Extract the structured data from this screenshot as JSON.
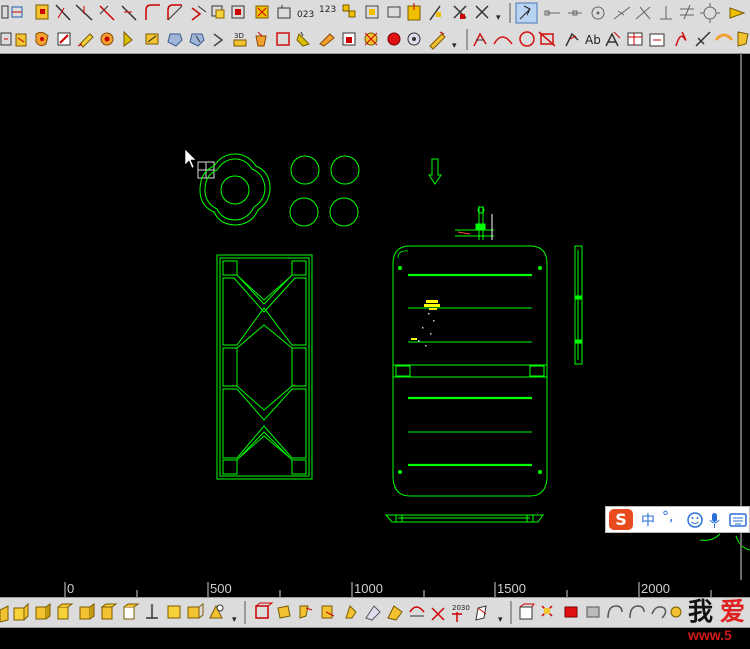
{
  "toolbars": {
    "top_row": {
      "icons": [
        "polyline-icon",
        "select-icon",
        "trim-icon",
        "extend-icon",
        "break-icon",
        "chamfer-icon",
        "fillet-icon",
        "offset-icon",
        "rotate-icon",
        "move-icon",
        "copy-icon",
        "array-icon",
        "explode-icon",
        "stretch-icon",
        "match-icon",
        "hatch-icon",
        "snap-icon",
        "line-icon",
        "circle-icon",
        "constraint-icon",
        "mirror-icon",
        "dimension-icon",
        "equal-icon"
      ],
      "text_labels": [
        "023",
        "123"
      ]
    },
    "second_row": {
      "icons": [
        "block-icon",
        "layer-icon",
        "properties-icon",
        "paint-icon",
        "pencil-icon",
        "insert-icon",
        "draw-order-icon",
        "3d-icon",
        "bucket-icon",
        "rectangle-icon",
        "eraser-icon",
        "explode-icon",
        "record-icon",
        "pen-icon",
        "arc-icon",
        "circle-icon",
        "rect-icon",
        "spline-icon",
        "text-icon",
        "leader-icon",
        "table-icon",
        "curve-icon",
        "scale-icon",
        "tag-icon"
      ],
      "text_labels": [
        "3D",
        "Ab"
      ]
    },
    "bottom_row": {
      "icons": [
        "cube-front-icon",
        "cube-back-icon",
        "cube-left-icon",
        "cube-right-icon",
        "cube-top-icon",
        "cube-bottom-icon",
        "view-icon",
        "iso-view-icon",
        "box-icon",
        "sphere-icon",
        "cylinder-icon",
        "cone-icon",
        "wedge-icon",
        "torus-icon",
        "extrude-icon",
        "revolve-icon",
        "sweep-icon",
        "loft-icon",
        "union-icon",
        "subtract-icon",
        "intersect-icon",
        "slice-icon",
        "render-icon",
        "light-icon",
        "material-icon",
        "camera-icon"
      ],
      "text_labels": [
        "2030"
      ]
    }
  },
  "ruler": {
    "labels": [
      "0",
      "500",
      "1000",
      "1500",
      "2000"
    ]
  },
  "ime": {
    "logo": "S",
    "mode": "中",
    "punct": "°,",
    "icons": [
      "emoji-icon",
      "microphone-icon",
      "keyboard-icon"
    ]
  },
  "watermark": {
    "text1": "我",
    "text2": "爱",
    "url": "www.5"
  },
  "colors": {
    "drawing": "#00ff00",
    "highlight": "#ffff00",
    "background": "#000000",
    "toolbar": "#dcdcdc"
  }
}
